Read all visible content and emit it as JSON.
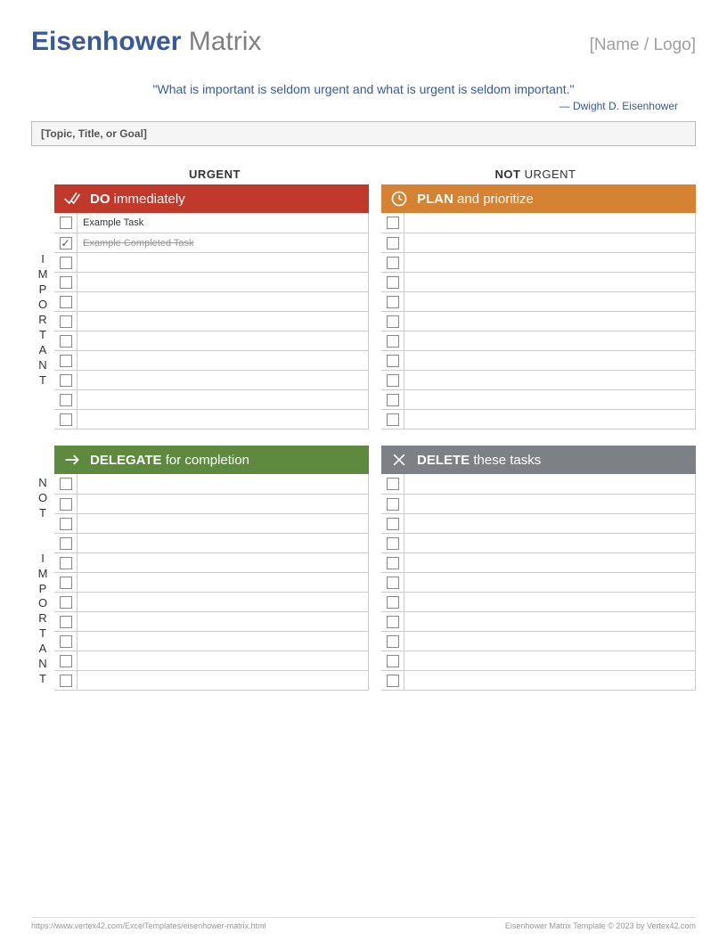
{
  "header": {
    "title_bold": "Eisenhower",
    "title_rest": " Matrix",
    "logo_placeholder": "[Name / Logo]"
  },
  "quote": {
    "text": "\"What is important is seldom urgent and what is urgent is seldom important.\"",
    "attribution": "— Dwight D. Eisenhower"
  },
  "topic_placeholder": "[Topic, Title, or Goal]",
  "columns": {
    "urgent_bold": "URGENT",
    "not": "NOT ",
    "not_urgent_rest": "URGENT"
  },
  "rows": {
    "important": "IMPORTANT",
    "not": "NOT",
    "not_important_rest": "IMPORTANT"
  },
  "quadrants": {
    "do": {
      "bold": "DO",
      "rest": " immediately"
    },
    "plan": {
      "bold": "PLAN",
      "rest": " and prioritize"
    },
    "delegate": {
      "bold": "DELEGATE",
      "rest": " for completion"
    },
    "delete": {
      "bold": "DELETE",
      "rest": " these tasks"
    }
  },
  "tasks": {
    "do": [
      {
        "text": "Example Task",
        "done": false
      },
      {
        "text": "Example Completed Task",
        "done": true
      },
      {
        "text": "",
        "done": false
      },
      {
        "text": "",
        "done": false
      },
      {
        "text": "",
        "done": false
      },
      {
        "text": "",
        "done": false
      },
      {
        "text": "",
        "done": false
      },
      {
        "text": "",
        "done": false
      },
      {
        "text": "",
        "done": false
      },
      {
        "text": "",
        "done": false
      },
      {
        "text": "",
        "done": false
      }
    ],
    "plan": [
      {
        "text": "",
        "done": false
      },
      {
        "text": "",
        "done": false
      },
      {
        "text": "",
        "done": false
      },
      {
        "text": "",
        "done": false
      },
      {
        "text": "",
        "done": false
      },
      {
        "text": "",
        "done": false
      },
      {
        "text": "",
        "done": false
      },
      {
        "text": "",
        "done": false
      },
      {
        "text": "",
        "done": false
      },
      {
        "text": "",
        "done": false
      },
      {
        "text": "",
        "done": false
      }
    ],
    "delegate": [
      {
        "text": "",
        "done": false
      },
      {
        "text": "",
        "done": false
      },
      {
        "text": "",
        "done": false
      },
      {
        "text": "",
        "done": false
      },
      {
        "text": "",
        "done": false
      },
      {
        "text": "",
        "done": false
      },
      {
        "text": "",
        "done": false
      },
      {
        "text": "",
        "done": false
      },
      {
        "text": "",
        "done": false
      },
      {
        "text": "",
        "done": false
      },
      {
        "text": "",
        "done": false
      }
    ],
    "delete": [
      {
        "text": "",
        "done": false
      },
      {
        "text": "",
        "done": false
      },
      {
        "text": "",
        "done": false
      },
      {
        "text": "",
        "done": false
      },
      {
        "text": "",
        "done": false
      },
      {
        "text": "",
        "done": false
      },
      {
        "text": "",
        "done": false
      },
      {
        "text": "",
        "done": false
      },
      {
        "text": "",
        "done": false
      },
      {
        "text": "",
        "done": false
      },
      {
        "text": "",
        "done": false
      }
    ]
  },
  "footer": {
    "url": "https://www.vertex42.com/ExcelTemplates/eisenhower-matrix.html",
    "copyright": "Eisenhower Matrix Template © 2023 by Vertex42.com"
  }
}
